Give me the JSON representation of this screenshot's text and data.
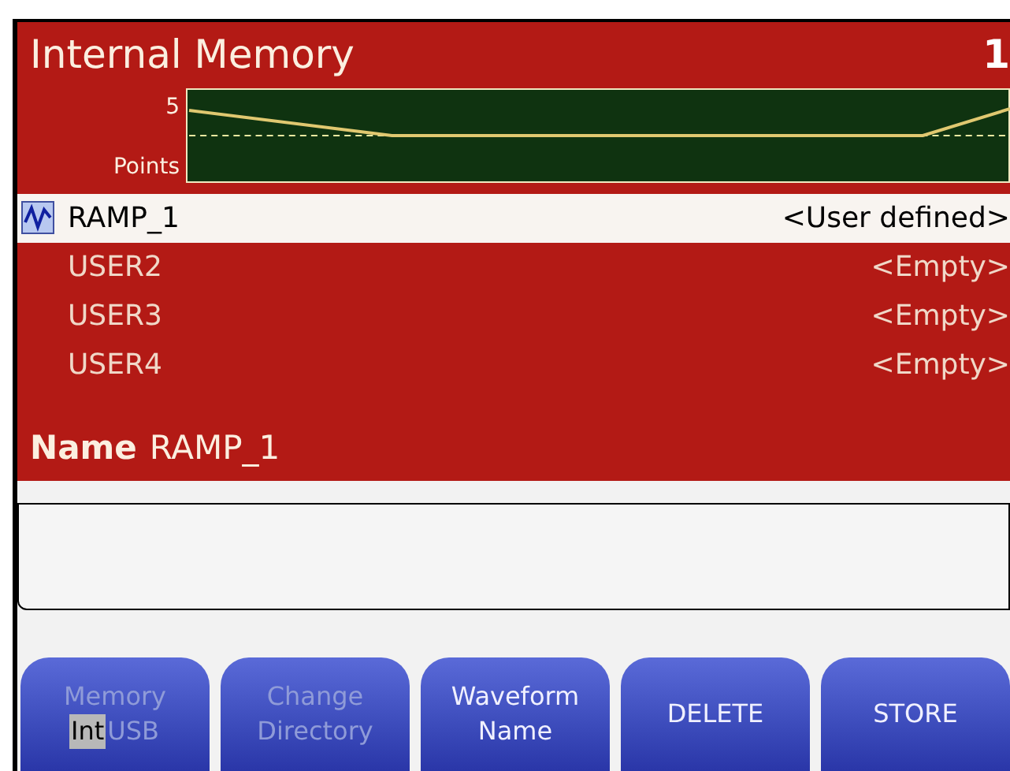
{
  "header": {
    "title": "Internal Memory",
    "page_number": "1"
  },
  "preview": {
    "y_label": "5",
    "x_label": "Points"
  },
  "files": [
    {
      "name": "RAMP_1",
      "status": "<User defined>",
      "selected": true,
      "has_waveform": true
    },
    {
      "name": "USER2",
      "status": "<Empty>",
      "selected": false,
      "has_waveform": false
    },
    {
      "name": "USER3",
      "status": "<Empty>",
      "selected": false,
      "has_waveform": false
    },
    {
      "name": "USER4",
      "status": "<Empty>",
      "selected": false,
      "has_waveform": false
    }
  ],
  "name_field": {
    "label": "Name",
    "value": "RAMP_1"
  },
  "softkeys": [
    {
      "kind": "toggle",
      "label": "Memory",
      "disabled": true,
      "options": [
        {
          "label": "Int",
          "selected": true
        },
        {
          "label": "USB",
          "selected": false
        }
      ]
    },
    {
      "kind": "text",
      "label": "Change Directory",
      "disabled": true
    },
    {
      "kind": "text",
      "label": "Waveform Name",
      "disabled": false
    },
    {
      "kind": "text",
      "label": "DELETE",
      "disabled": false
    },
    {
      "kind": "text",
      "label": "STORE",
      "disabled": false
    }
  ]
}
